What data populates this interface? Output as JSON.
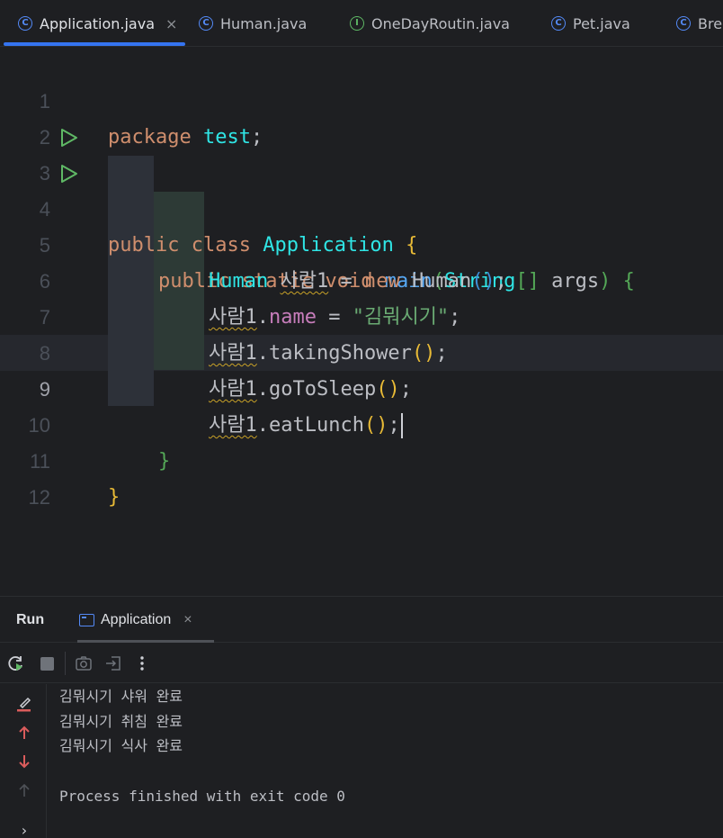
{
  "tabs": [
    {
      "label": "Application.java",
      "icon": "class-icon",
      "active": true
    },
    {
      "label": "Human.java",
      "icon": "class-icon"
    },
    {
      "label": "OneDayRoutin.java",
      "icon": "interface-icon"
    },
    {
      "label": "Pet.java",
      "icon": "class-icon"
    },
    {
      "label": "Bre",
      "icon": "class-icon"
    }
  ],
  "editor": {
    "line_numbers": [
      "1",
      "2",
      "3",
      "4",
      "5",
      "6",
      "7",
      "8",
      "9",
      "10",
      "11",
      "12"
    ],
    "current_line": "9",
    "tokens": {
      "package_kw": "package",
      "package_name": "test",
      "semicolon": ";",
      "public_kw": "public",
      "class_kw": "class",
      "class_name": "Application",
      "static_kw": "static",
      "void_kw": "void",
      "main_name": "main",
      "string_type": "String",
      "args_name": "args",
      "human_type": "Human",
      "var_name": "사람1",
      "assign": "=",
      "new_kw": "new",
      "name_field": "name",
      "name_value": "\"김뭐시기\"",
      "taking_shower": "takingShower",
      "go_to_sleep": "goToSleep",
      "eat_lunch": "eatLunch"
    }
  },
  "run_panel": {
    "title": "Run",
    "tab_label": "Application",
    "console_lines": [
      "김뭐시기 샤워 완료",
      "김뭐시기 취침 완료",
      "김뭐시기 식사 완료",
      "",
      "Process finished with exit code 0"
    ]
  },
  "colors": {
    "background": "#1e1f22",
    "keyword": "#cf8e6d",
    "class_name": "#2fe5e5",
    "method": "#56a8f5",
    "field": "#c77dbb",
    "string": "#6aab73",
    "accent": "#3574f0"
  }
}
